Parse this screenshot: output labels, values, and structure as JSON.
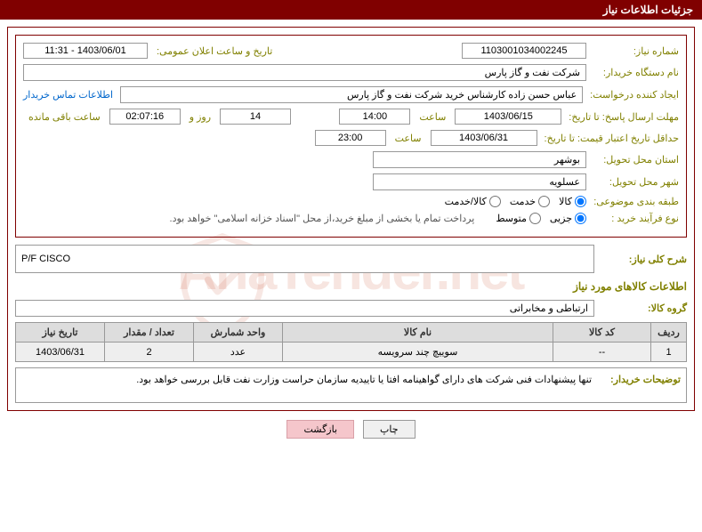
{
  "header": {
    "title": "جزئیات اطلاعات نیاز"
  },
  "fields": {
    "need_number_label": "شماره نیاز:",
    "need_number": "1103001034002245",
    "announce_date_label": "تاریخ و ساعت اعلان عمومی:",
    "announce_date": "1403/06/01 - 11:31",
    "buyer_org_label": "نام دستگاه خریدار:",
    "buyer_org": "شرکت نفت و گاز پارس",
    "requester_label": "ایجاد کننده درخواست:",
    "requester": "عباس حسن زاده کارشناس خرید شرکت نفت و گاز پارس",
    "buyer_contact_link": "اطلاعات تماس خریدار",
    "response_deadline_label": "مهلت ارسال پاسخ: تا تاریخ:",
    "response_deadline_date": "1403/06/15",
    "time_label": "ساعت",
    "response_deadline_time": "14:00",
    "days_label": "روز و",
    "days_remaining": "14",
    "remaining_time": "02:07:16",
    "remaining_label": "ساعت باقی مانده",
    "price_validity_label": "حداقل تاریخ اعتبار قیمت: تا تاریخ:",
    "price_validity_date": "1403/06/31",
    "price_validity_time": "23:00",
    "delivery_province_label": "استان محل تحویل:",
    "delivery_province": "بوشهر",
    "delivery_city_label": "شهر محل تحویل:",
    "delivery_city": "عسلویه",
    "category_label": "طبقه بندی موضوعی:",
    "cat_goods": "کالا",
    "cat_service": "خدمت",
    "cat_goods_service": "کالا/خدمت",
    "purchase_type_label": "نوع فرآیند خرید :",
    "type_partial": "جزیی",
    "type_medium": "متوسط",
    "purchase_note": "پرداخت تمام یا بخشی از مبلغ خرید،از محل \"اسناد خزانه اسلامی\" خواهد بود.",
    "general_desc_label": "شرح کلی نیاز:",
    "general_desc": "P/F CISCO",
    "goods_info_title": "اطلاعات کالاهای مورد نیاز",
    "goods_group_label": "گروه کالا:",
    "goods_group": "ارتباطی و مخابراتی",
    "remarks_label": "توضیحات خریدار:",
    "remarks": "تنها پیشنهادات فنی شرکت های دارای گواهینامه افتا یا تاییدیه سازمان حراست وزارت نفت قابل بررسی خواهد بود."
  },
  "table": {
    "headers": {
      "row": "ردیف",
      "code": "کد کالا",
      "name": "نام کالا",
      "unit": "واحد شمارش",
      "qty": "تعداد / مقدار",
      "date": "تاریخ نیاز"
    },
    "rows": [
      {
        "row": "1",
        "code": "--",
        "name": "سوییچ چند سرویسه",
        "unit": "عدد",
        "qty": "2",
        "date": "1403/06/31"
      }
    ]
  },
  "buttons": {
    "print": "چاپ",
    "back": "بازگشت"
  },
  "watermark": "AriaTender.net"
}
